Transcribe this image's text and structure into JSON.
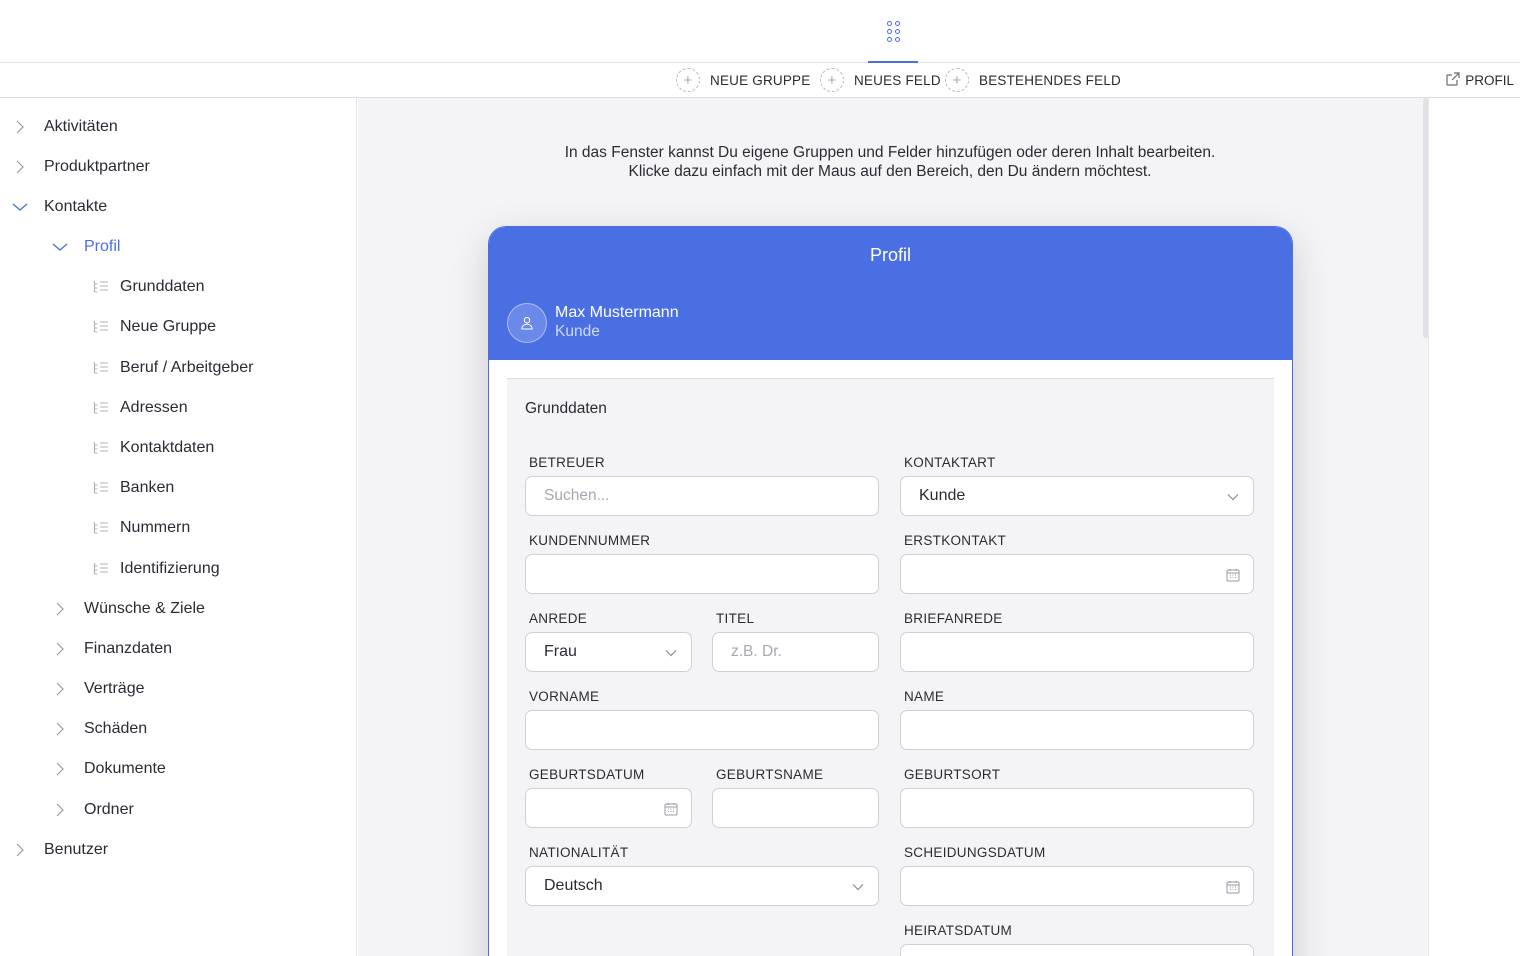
{
  "toolbar": {
    "new_group": "NEUE GRUPPE",
    "new_field": "NEUES FELD",
    "existing_field": "BESTEHENDES FELD",
    "profile": "PROFIL"
  },
  "sidebar": {
    "items": [
      {
        "label": "Aktivitäten"
      },
      {
        "label": "Produktpartner"
      },
      {
        "label": "Kontakte"
      },
      {
        "label": "Profil"
      },
      {
        "label": "Grunddaten"
      },
      {
        "label": "Neue Gruppe"
      },
      {
        "label": "Beruf / Arbeitgeber"
      },
      {
        "label": "Adressen"
      },
      {
        "label": "Kontaktdaten"
      },
      {
        "label": "Banken"
      },
      {
        "label": "Nummern"
      },
      {
        "label": "Identifizierung"
      },
      {
        "label": "Wünsche & Ziele"
      },
      {
        "label": "Finanzdaten"
      },
      {
        "label": "Verträge"
      },
      {
        "label": "Schäden"
      },
      {
        "label": "Dokumente"
      },
      {
        "label": "Ordner"
      },
      {
        "label": "Benutzer"
      }
    ]
  },
  "main": {
    "intro_line1": "In das Fenster kannst Du eigene Gruppen und Felder hinzufügen oder deren Inhalt bearbeiten.",
    "intro_line2": "Klicke dazu einfach mit der Maus auf den Bereich, den Du ändern möchtest."
  },
  "card": {
    "title": "Profil",
    "user_name": "Max Mustermann",
    "user_role": "Kunde",
    "group_title": "Grunddaten",
    "fields": {
      "betreuer": {
        "label": "BETREUER",
        "placeholder": "Suchen..."
      },
      "kontaktart": {
        "label": "KONTAKTART",
        "value": "Kunde"
      },
      "kundennummer": {
        "label": "KUNDENNUMMER",
        "value": ""
      },
      "erstkontakt": {
        "label": "ERSTKONTAKT",
        "value": ""
      },
      "anrede": {
        "label": "ANREDE",
        "value": "Frau"
      },
      "titel": {
        "label": "TITEL",
        "placeholder": "z.B. Dr."
      },
      "briefanrede": {
        "label": "BRIEFANREDE",
        "value": ""
      },
      "vorname": {
        "label": "VORNAME",
        "value": ""
      },
      "name": {
        "label": "NAME",
        "value": ""
      },
      "geburtsdatum": {
        "label": "GEBURTSDATUM",
        "value": ""
      },
      "geburtsname": {
        "label": "GEBURTSNAME",
        "value": ""
      },
      "geburtsort": {
        "label": "GEBURTSORT",
        "value": ""
      },
      "nationalitaet": {
        "label": "NATIONALITÄT",
        "value": "Deutsch"
      },
      "scheidungsdatum": {
        "label": "SCHEIDUNGSDATUM",
        "value": ""
      },
      "heiratsdatum": {
        "label": "HEIRATSDATUM",
        "value": ""
      }
    }
  },
  "colors": {
    "accent": "#4a6fe3"
  }
}
